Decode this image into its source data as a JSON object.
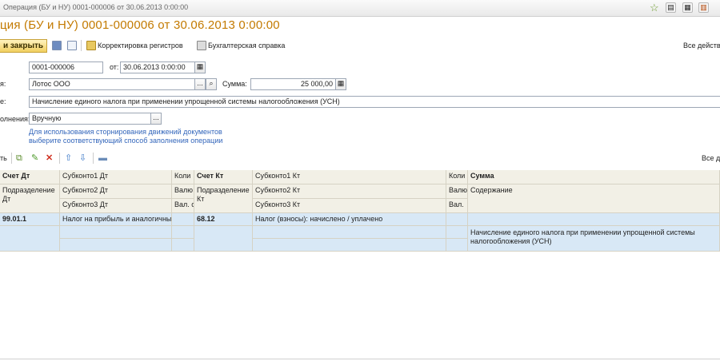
{
  "window": {
    "title": "Операция (БУ и НУ) 0001-000006 от 30.06.2013 0:00:00"
  },
  "heading": "ция (БУ и НУ) 0001-000006 от 30.06.2013 0:00:00",
  "toolbar": {
    "close_label": "и закрыть",
    "correction_label": "Корректировка регистров",
    "reference_label": "Бухгалтерская справка",
    "all_actions_label": "Все действ"
  },
  "form": {
    "number": "0001-000006",
    "date_label": "от:",
    "date": "30.06.2013 0:00:00",
    "org_label": "я:",
    "org": "Лотос ООО",
    "sum_label": "Сумма:",
    "sum": "25 000,00",
    "content_label": "е:",
    "content": "Начисление единого налога при применении упрощенной системы налогообложения (УСН)",
    "fill_label": "олнения:",
    "fill_method": "Вручную",
    "hint_line1": "Для использования сторнирования движений документов",
    "hint_line2": "выберите соответствующий способ заполнения операции"
  },
  "table_toolbar": {
    "add_label": "ть",
    "all_actions_label": "Все д"
  },
  "table": {
    "headers": {
      "r1": [
        "Счет Дт",
        "Субконто1 Дт",
        "Коли",
        "Счет Кт",
        "Субконто1 Кт",
        "Коли",
        "Сумма"
      ],
      "r2": [
        "Подразделение Дт",
        "Субконто2 Дт",
        "Валю",
        "Подразделение Кт",
        "Субконто2 Кт",
        "Валю",
        "Содержание"
      ],
      "r3": [
        "",
        "Субконто3 Дт",
        "Вал. с",
        "",
        "Субконто3 Кт",
        "Вал.",
        ""
      ]
    },
    "rows": [
      {
        "account_dt": "99.01.1",
        "subconto1_dt": "Налог на прибыль и аналогичны",
        "account_kt": "68.12",
        "subconto1_kt": "Налог (взносы): начислено / уплачено",
        "content_line1": "Начисление единого налога при применении упрощенной системы",
        "content_line2": "налогообложения (УСН)"
      }
    ]
  },
  "colors": {
    "heading": "#c37a00",
    "selected_row": "#d8e8f6",
    "link": "#3366bb"
  }
}
